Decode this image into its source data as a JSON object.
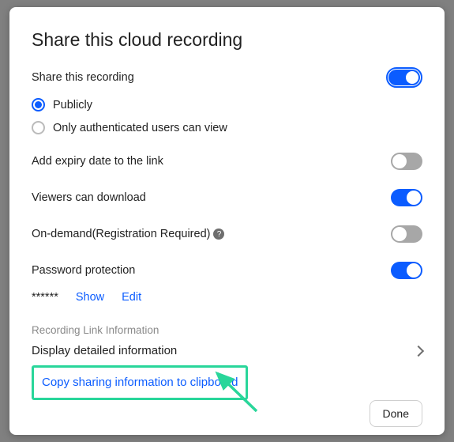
{
  "title": "Share this cloud recording",
  "share_label": "Share this recording",
  "radios": {
    "publicly": "Publicly",
    "authenticated": "Only authenticated users can view"
  },
  "expiry_label": "Add expiry date to the link",
  "download_label": "Viewers can download",
  "ondemand_label": "On-demand(Registration Required)",
  "password_label": "Password protection",
  "password_masked": "******",
  "show_label": "Show",
  "edit_label": "Edit",
  "section_label": "Recording Link Information",
  "display_label": "Display detailed information",
  "copy_label": "Copy sharing information to clipboard",
  "done_label": "Done",
  "colors": {
    "accent": "#0b5cff",
    "highlight": "#29d69a"
  }
}
